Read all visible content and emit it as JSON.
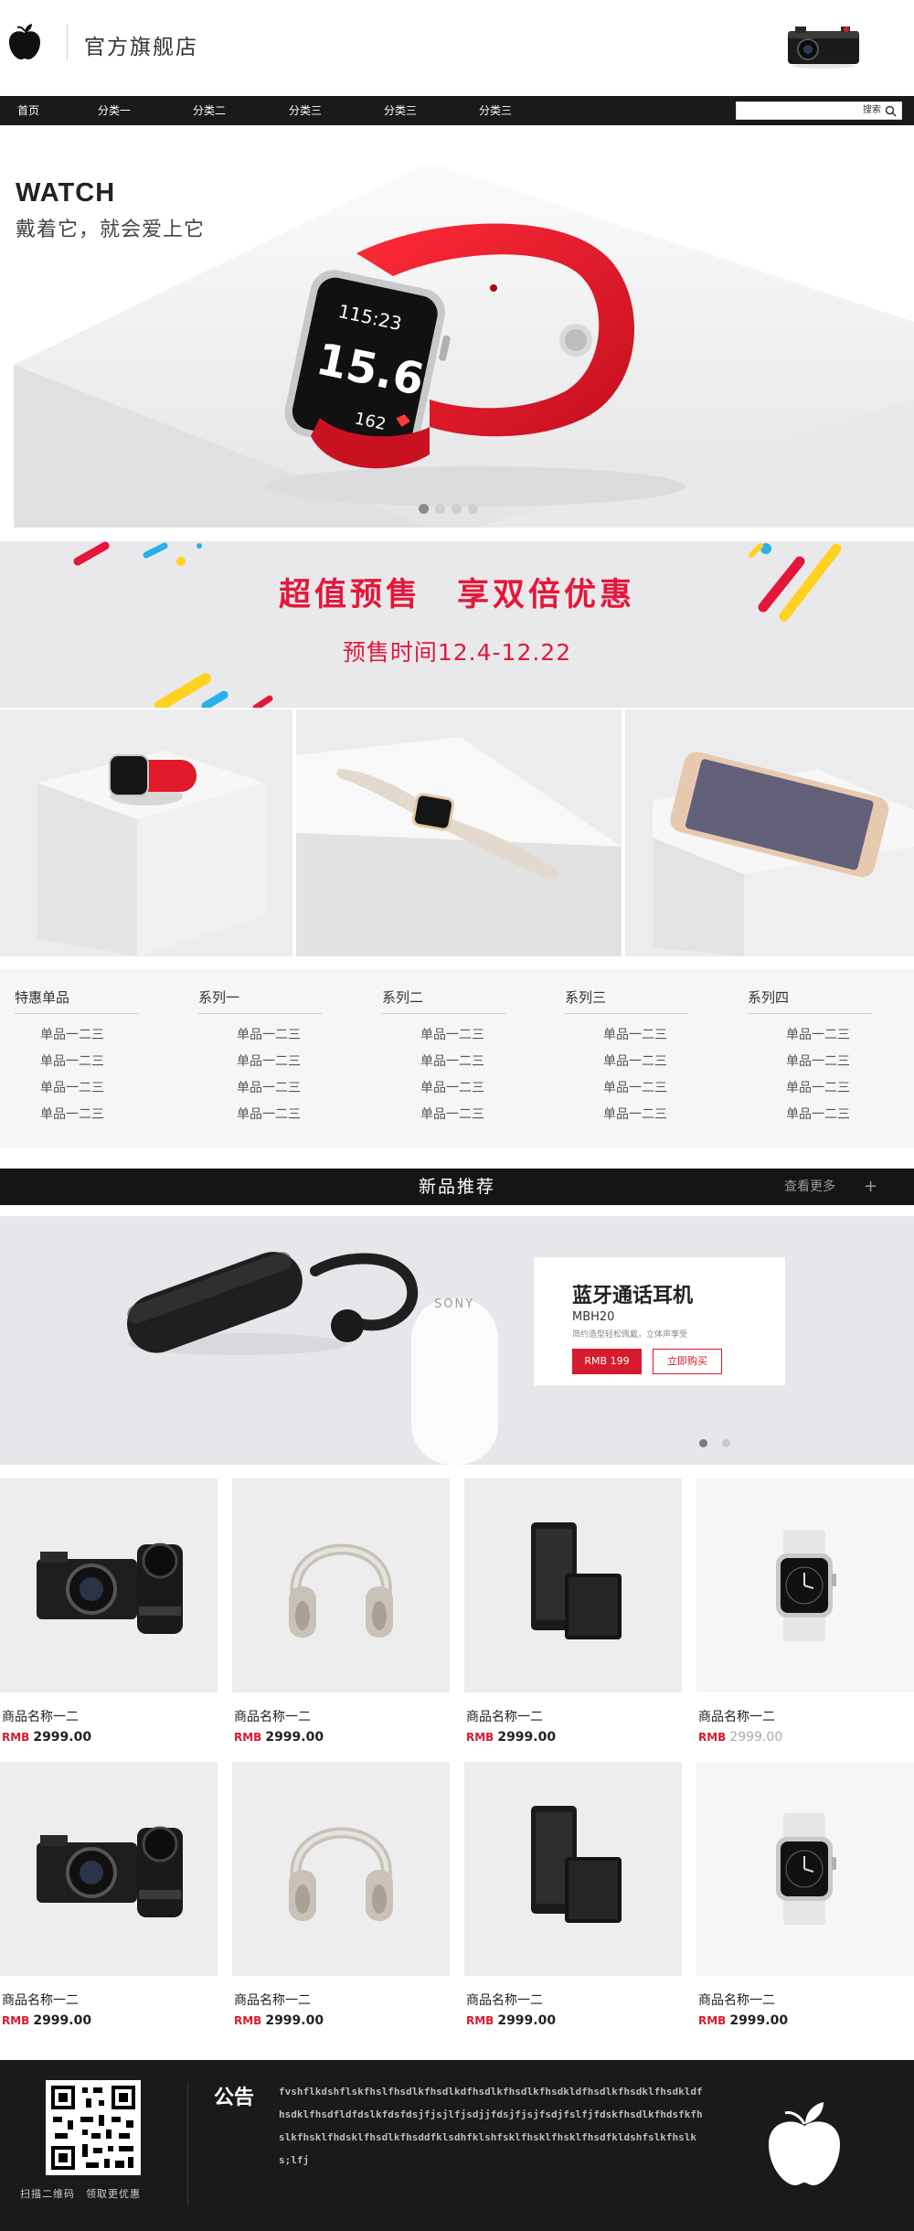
{
  "header": {
    "store_name": "官方旗舰店"
  },
  "nav": {
    "items": [
      "首页",
      "分类一",
      "分类二",
      "分类三",
      "分类三",
      "分类三"
    ],
    "search_placeholder": "",
    "search_label": "搜索"
  },
  "hero": {
    "title": "WATCH",
    "subtitle": "戴着它，就会爱上它",
    "watch_screen": {
      "top": "115:23",
      "middle": "15.6",
      "bottom": "162"
    },
    "slide_count": 4,
    "active_slide": 1
  },
  "promo": {
    "title": "超值预售　享双倍优惠",
    "date": "预售时间12.4-12.22"
  },
  "categories": [
    {
      "title": "特惠单品",
      "links": [
        "单品一二三",
        "单品一二三",
        "单品一二三",
        "单品一二三"
      ]
    },
    {
      "title": "系列一",
      "links": [
        "单品一二三",
        "单品一二三",
        "单品一二三",
        "单品一二三"
      ]
    },
    {
      "title": "系列二",
      "links": [
        "单品一二三",
        "单品一二三",
        "单品一二三",
        "单品一二三"
      ]
    },
    {
      "title": "系列三",
      "links": [
        "单品一二三",
        "单品一二三",
        "单品一二三",
        "单品一二三"
      ]
    },
    {
      "title": "系列四",
      "links": [
        "单品一二三",
        "单品一二三",
        "单品一二三",
        "单品一二三"
      ]
    }
  ],
  "new_products": {
    "title": "新品推荐",
    "more": "查看更多",
    "plus": "+"
  },
  "feature": {
    "name": "蓝牙通话耳机",
    "model": "MBH20",
    "desc": "简约造型轻松佩戴，立体声享受",
    "price": "RMB 199",
    "buy": "立即购买",
    "brand": "SONY",
    "slide_count": 2,
    "active_slide": 1
  },
  "products": [
    {
      "name": "商品名称一二",
      "currency": "RMB",
      "price": "2999.00",
      "icon": "camera-icon"
    },
    {
      "name": "商品名称一二",
      "currency": "RMB",
      "price": "2999.00",
      "icon": "headphones-icon"
    },
    {
      "name": "商品名称一二",
      "currency": "RMB",
      "price": "2999.00",
      "icon": "phone-icon"
    },
    {
      "name": "商品名称一二",
      "currency": "RMB",
      "price": "2999.00",
      "icon": "watch-icon"
    },
    {
      "name": "商品名称一二",
      "currency": "RMB",
      "price": "2999.00",
      "icon": "camera-icon"
    },
    {
      "name": "商品名称一二",
      "currency": "RMB",
      "price": "2999.00",
      "icon": "headphones-icon"
    },
    {
      "name": "商品名称一二",
      "currency": "RMB",
      "price": "2999.00",
      "icon": "phone-icon"
    },
    {
      "name": "商品名称一二",
      "currency": "RMB",
      "price": "2999.00",
      "icon": "watch-icon"
    }
  ],
  "footer": {
    "qr_text": "扫描二维码　领取更优惠",
    "notice_title": "公告",
    "notice_text": "fvshflkdshflskfhslfhsdlkfhsdlkdfhsdlkfhsdlkfhsdkldfhsdlkfhsdklfhsdkldfhsdklfhsdfldfdslkfdsfdsjfjsjlfjsdjjfdsjfjsjfsdjfslfjfdskfhsdlkfhdsfkfhslkfhsklfhdsklfhsdlkfhsddfklsdhfklshfsklfhsklfhsklfhsdfkldshfslkfhslks;lfj"
  },
  "colors": {
    "accent_red": "#d61b2e",
    "promo_red": "#e4173b",
    "nav_bg": "#1a1a1a"
  }
}
